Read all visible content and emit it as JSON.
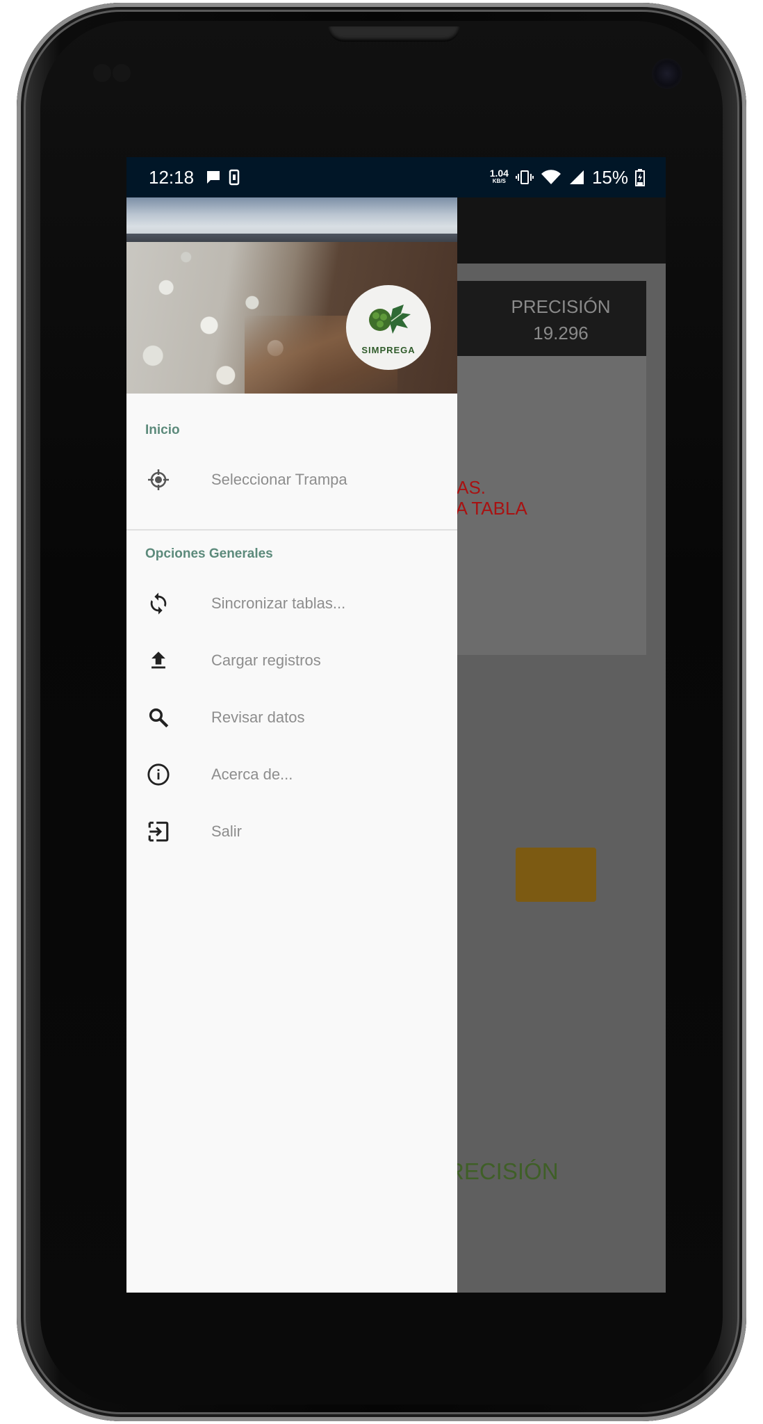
{
  "status_bar": {
    "time": "12:18",
    "speed_value": "1.04",
    "speed_unit": "KB/S",
    "battery": "15%"
  },
  "background_app": {
    "precision_label": "PRECISIÓN",
    "precision_value": "19.296",
    "warning_text": "GNADAS.\nZAR LA TABLA\nS",
    "footer_label": "PRECISIÓN"
  },
  "drawer": {
    "header": {
      "logo_text": "SIMPREGA"
    },
    "sections": [
      {
        "title": "Inicio",
        "items": [
          {
            "label": "Seleccionar Trampa",
            "icon": "crosshair-icon"
          }
        ]
      },
      {
        "title": "Opciones Generales",
        "items": [
          {
            "label": "Sincronizar tablas...",
            "icon": "sync-icon"
          },
          {
            "label": "Cargar registros",
            "icon": "upload-icon"
          },
          {
            "label": "Revisar datos",
            "icon": "search-icon"
          },
          {
            "label": "Acerca de...",
            "icon": "info-icon"
          },
          {
            "label": "Salir",
            "icon": "exit-icon"
          }
        ]
      }
    ]
  },
  "colors": {
    "status_bar": "#011627",
    "section_title": "#5c8a7b",
    "warning_text": "#a81212",
    "footer_label": "#3f5f27"
  }
}
